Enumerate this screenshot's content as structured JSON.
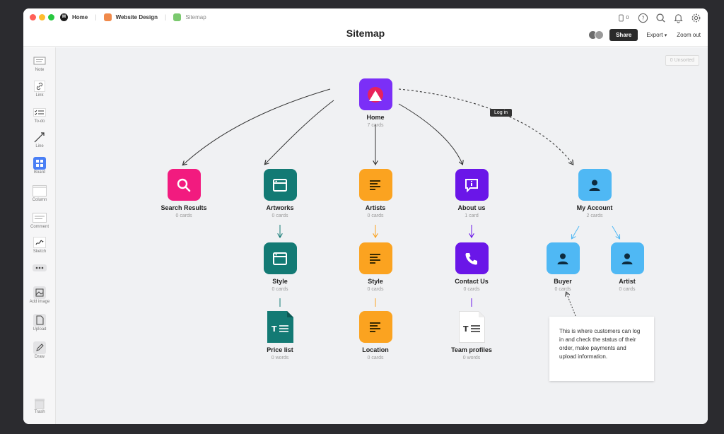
{
  "window": {
    "traffic_lights": [
      "#ff5f57",
      "#febc2e",
      "#28c840"
    ],
    "breadcrumbs": [
      {
        "label": "Home",
        "icon": "milanote-logo-icon",
        "color": "#1b1b1b"
      },
      {
        "label": "Website Design",
        "icon": "board-icon",
        "color": "#f08a4b"
      },
      {
        "label": "Sitemap",
        "icon": "board-icon",
        "color": "#7bc96f"
      }
    ],
    "title": "Sitemap",
    "phone_count": "0",
    "share_label": "Share",
    "export_label": "Export",
    "zoom_label": "Zoom out"
  },
  "sidebar": {
    "tools": [
      {
        "label": "Note",
        "icon": "note-icon"
      },
      {
        "label": "Link",
        "icon": "link-icon"
      },
      {
        "label": "To-do",
        "icon": "todo-icon"
      },
      {
        "label": "Line",
        "icon": "line-icon"
      },
      {
        "label": "Board",
        "icon": "board-icon"
      },
      {
        "label": "Column",
        "icon": "column-icon"
      },
      {
        "label": "Comment",
        "icon": "comment-icon"
      },
      {
        "label": "Sketch",
        "icon": "sketch-icon"
      },
      {
        "label": "",
        "icon": "more-icon"
      },
      {
        "label": "Add image",
        "icon": "image-icon"
      },
      {
        "label": "Upload",
        "icon": "upload-icon"
      },
      {
        "label": "Draw",
        "icon": "pen-icon"
      },
      {
        "label": "Trash",
        "icon": "trash-icon"
      }
    ]
  },
  "canvas": {
    "unsorted_label": "0 Unsorted",
    "login_label": "Log in",
    "note_text": "This is where customers can log in and check the status of their order, make payments and upload information.",
    "cards": [
      {
        "id": "home",
        "title": "Home",
        "sub": "7 cards",
        "color": "#7b2ff7",
        "icon": "logo-triangle-icon"
      },
      {
        "id": "search",
        "title": "Search Results",
        "sub": "0 cards",
        "color": "#f21b7f",
        "icon": "search-icon"
      },
      {
        "id": "artworks",
        "title": "Artworks",
        "sub": "0 cards",
        "color": "#137a74",
        "icon": "browser-window-icon"
      },
      {
        "id": "artists",
        "title": "Artists",
        "sub": "0 cards",
        "color": "#fba320",
        "icon": "text-lines-icon"
      },
      {
        "id": "about",
        "title": "About us",
        "sub": "1 card",
        "color": "#6a16e8",
        "icon": "info-chat-icon"
      },
      {
        "id": "account",
        "title": "My Account",
        "sub": "2 cards",
        "color": "#4fb8f4",
        "icon": "person-icon"
      },
      {
        "id": "style1",
        "title": "Style",
        "sub": "0 cards",
        "color": "#137a74",
        "icon": "browser-window-icon"
      },
      {
        "id": "style2",
        "title": "Style",
        "sub": "0 cards",
        "color": "#fba320",
        "icon": "text-lines-icon"
      },
      {
        "id": "contact",
        "title": "Contact Us",
        "sub": "0 cards",
        "color": "#6a16e8",
        "icon": "phone-icon"
      },
      {
        "id": "buyer",
        "title": "Buyer",
        "sub": "0 cards",
        "color": "#4fb8f4",
        "icon": "person-icon"
      },
      {
        "id": "artist",
        "title": "Artist",
        "sub": "0 cards",
        "color": "#4fb8f4",
        "icon": "person-icon"
      },
      {
        "id": "price",
        "title": "Price list",
        "sub": "0 words",
        "color": "#137a74",
        "icon": "document-icon"
      },
      {
        "id": "location",
        "title": "Location",
        "sub": "0 cards",
        "color": "#fba320",
        "icon": "text-lines-icon"
      },
      {
        "id": "team",
        "title": "Team profiles",
        "sub": "0 words",
        "color": "#ffffff",
        "icon": "document-icon"
      }
    ]
  }
}
